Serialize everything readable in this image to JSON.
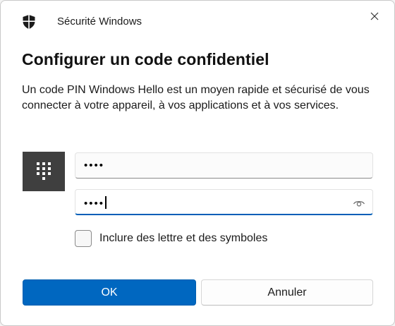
{
  "window": {
    "app_title": "Sécurité Windows",
    "close_icon": "close-icon",
    "app_icon": "windows-security-shield-icon"
  },
  "dialog": {
    "heading": "Configurer un code confidentiel",
    "description": "Un code PIN Windows Hello est un moyen rapide et sécurisé de vous connecter à votre appareil, à vos applications et à vos services."
  },
  "pin": {
    "tile_icon": "pin-keypad-icon",
    "new_pin_value": "••••",
    "confirm_pin_value": "••••",
    "reveal_icon": "eye-icon"
  },
  "options": {
    "include_letters_label": "Inclure des lettre et des symboles",
    "include_letters_checked": false
  },
  "buttons": {
    "ok_label": "OK",
    "cancel_label": "Annuler"
  },
  "colors": {
    "accent": "#0067c0",
    "focus_underline": "#005fb8",
    "tile_background": "#3f3f3f"
  }
}
